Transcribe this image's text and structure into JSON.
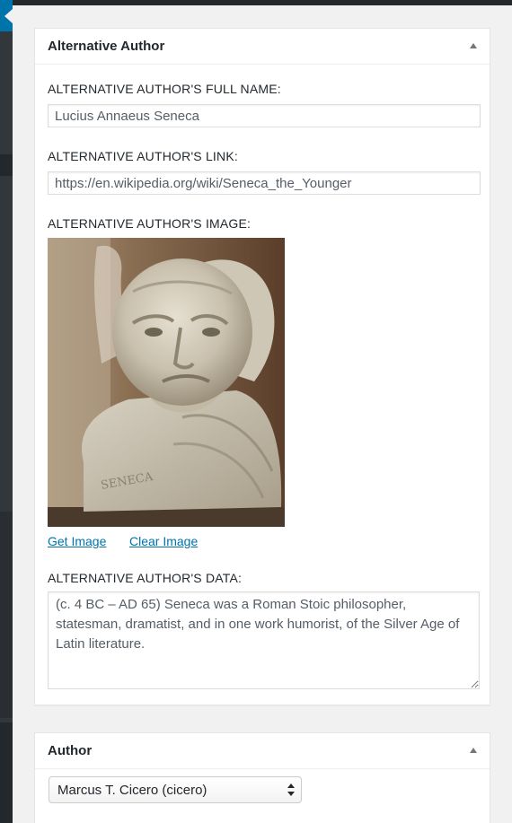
{
  "alt_author_box": {
    "title": "Alternative Author",
    "full_name_label": "ALTERNATIVE AUTHOR'S FULL NAME:",
    "full_name_value": "Lucius Annaeus Seneca",
    "link_label": "ALTERNATIVE AUTHOR'S LINK:",
    "link_value": "https://en.wikipedia.org/wiki/Seneca_the_Younger",
    "image_label": "ALTERNATIVE AUTHOR'S IMAGE:",
    "get_image_label": "Get Image",
    "clear_image_label": "Clear Image",
    "data_label": "ALTERNATIVE AUTHOR'S DATA:",
    "data_value": "(c. 4 BC – AD 65) Seneca was a Roman Stoic philosopher, statesman, dramatist, and in one work humorist, of the Silver Age of Latin literature."
  },
  "author_box": {
    "title": "Author",
    "selected_author": "Marcus T. Cicero (cicero)"
  },
  "icons": {
    "toggle": "triangle-up-icon",
    "select": "chevron-up-down-icon"
  },
  "colors": {
    "link": "#0073aa",
    "admin_menu": "#32373c",
    "admin_active": "#0073aa",
    "background": "#f1f1f1"
  }
}
